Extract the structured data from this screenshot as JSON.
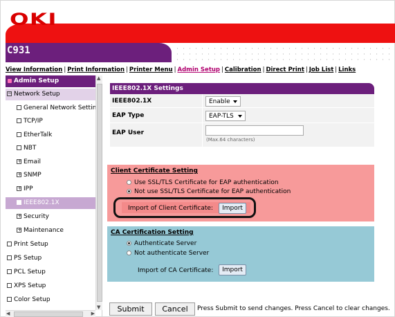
{
  "brand": {
    "logo": "OKI",
    "model": "C931"
  },
  "top_nav": [
    {
      "label": "View Information",
      "active": false
    },
    {
      "label": "Print Information",
      "active": false
    },
    {
      "label": "Printer Menu",
      "active": false
    },
    {
      "label": "Admin Setup",
      "active": true
    },
    {
      "label": "Calibration",
      "active": false
    },
    {
      "label": "Direct Print",
      "active": false
    },
    {
      "label": "Job List",
      "active": false
    },
    {
      "label": "Links",
      "active": false
    }
  ],
  "sidebar": {
    "header": "Admin Setup",
    "items": [
      {
        "label": "Network Setup",
        "icon": "minus-box-icon"
      },
      {
        "label": "General Network Setting",
        "icon": "box-icon"
      },
      {
        "label": "TCP/IP",
        "icon": "box-icon"
      },
      {
        "label": "EtherTalk",
        "icon": "box-icon"
      },
      {
        "label": "NBT",
        "icon": "box-icon"
      },
      {
        "label": "Email",
        "icon": "plus-box-icon"
      },
      {
        "label": "SNMP",
        "icon": "plus-box-icon"
      },
      {
        "label": "IPP",
        "icon": "plus-box-icon"
      },
      {
        "label": "IEEE802.1X",
        "icon": "box-icon",
        "selected": true
      },
      {
        "label": "Security",
        "icon": "plus-box-icon"
      },
      {
        "label": "Maintenance",
        "icon": "plus-box-icon"
      },
      {
        "label": "Print Setup",
        "icon": "box-icon"
      },
      {
        "label": "PS Setup",
        "icon": "box-icon"
      },
      {
        "label": "PCL Setup",
        "icon": "box-icon"
      },
      {
        "label": "XPS Setup",
        "icon": "box-icon"
      },
      {
        "label": "Color Setup",
        "icon": "box-icon"
      }
    ]
  },
  "settings": {
    "title": "IEEE802.1X Settings",
    "ieee_label": "IEEE802.1X",
    "ieee_value": "Enable",
    "eap_type_label": "EAP Type",
    "eap_type_value": "EAP-TLS",
    "eap_user_label": "EAP User",
    "eap_user_value": "",
    "eap_user_hint": "(Max.64 characters)"
  },
  "client_cert": {
    "title": "Client Certificate Setting",
    "option_use": "Use SSL/TLS Certificate for EAP authentication",
    "option_not_use": "Not use SSL/TLS Certificate for EAP authentication",
    "selected": "not_use",
    "import_label": "Import of Client Certificate:",
    "import_button": "Import"
  },
  "ca_cert": {
    "title": "CA Certification Setting",
    "option_auth": "Authenticate Server",
    "option_no_auth": "Not authenticate Server",
    "selected": "auth",
    "import_label": "Import of CA Certificate:",
    "import_button": "Import"
  },
  "footer": {
    "submit": "Submit",
    "cancel": "Cancel",
    "message": "Press Submit to send changes. Press Cancel to clear changes."
  },
  "colors": {
    "brand_red": "#ee1111",
    "brand_purple": "#6c1f7c",
    "client_bg": "#f79a9a",
    "ca_bg": "#96c9d6"
  }
}
